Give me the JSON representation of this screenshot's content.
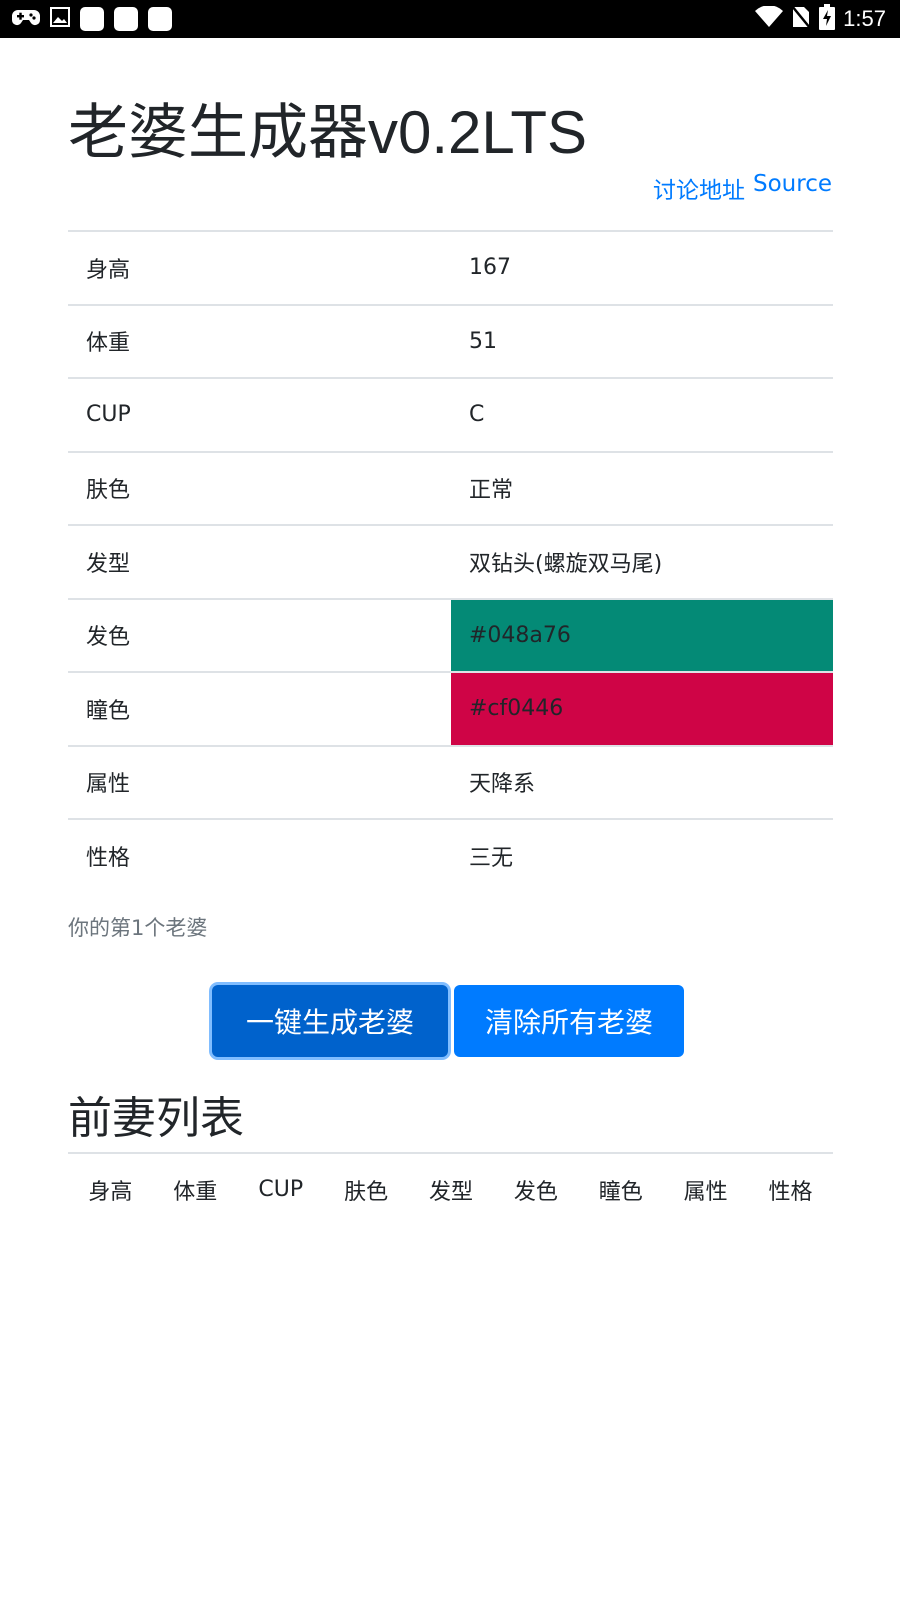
{
  "status_bar": {
    "time": "1:57",
    "icons_left": [
      "game-controller-icon",
      "image-icon",
      "app-icon",
      "app-icon",
      "app-icon"
    ],
    "icons_right": [
      "wifi-icon",
      "no-sim-icon",
      "battery-charging-icon"
    ]
  },
  "page": {
    "title": "老婆生成器v0.2LTS",
    "links": {
      "discuss": "讨论地址",
      "source": "Source"
    }
  },
  "attributes": [
    {
      "key": "身高",
      "value": "167"
    },
    {
      "key": "体重",
      "value": "51"
    },
    {
      "key": "CUP",
      "value": "C"
    },
    {
      "key": "肤色",
      "value": "正常"
    },
    {
      "key": "发型",
      "value": "双钻头(螺旋双马尾)"
    },
    {
      "key": "发色",
      "value": "#048a76",
      "bg": "#048a76"
    },
    {
      "key": "瞳色",
      "value": "#cf0446",
      "bg": "#cf0446"
    },
    {
      "key": "属性",
      "value": "天降系"
    },
    {
      "key": "性格",
      "value": "三无"
    }
  ],
  "caption": "你的第1个老婆",
  "buttons": {
    "generate": "一键生成老婆",
    "clear": "清除所有老婆"
  },
  "ex_list": {
    "heading": "前妻列表",
    "columns": [
      "身高",
      "体重",
      "CUP",
      "肤色",
      "发型",
      "发色",
      "瞳色",
      "属性",
      "性格"
    ]
  },
  "colors": {
    "primary": "#007bff",
    "primary_active": "#0062cc",
    "muted": "#6c757d"
  }
}
